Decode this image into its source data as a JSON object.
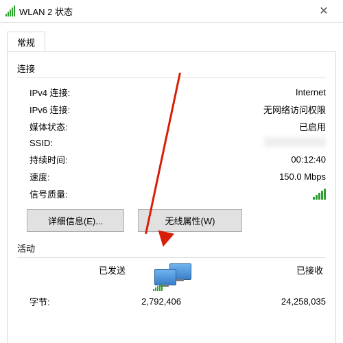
{
  "title": "WLAN 2 状态",
  "tab": "常规",
  "connection": {
    "header": "连接",
    "rows": {
      "ipv4": {
        "k": "IPv4 连接:",
        "v": "Internet"
      },
      "ipv6": {
        "k": "IPv6 连接:",
        "v": "无网络访问权限"
      },
      "media": {
        "k": "媒体状态:",
        "v": "已启用"
      },
      "ssid": {
        "k": "SSID:",
        "v": ""
      },
      "duration": {
        "k": "持续时间:",
        "v": "00:12:40"
      },
      "speed": {
        "k": "速度:",
        "v": "150.0 Mbps"
      },
      "signal": {
        "k": "信号质量:"
      }
    }
  },
  "buttons": {
    "details": "详细信息(E)...",
    "wireless": "无线属性(W)"
  },
  "activity": {
    "header": "活动",
    "sent": "已发送",
    "received": "已接收",
    "bytesLabel": "字节:",
    "bytesSent": "2,792,406",
    "bytesReceived": "24,258,035"
  }
}
